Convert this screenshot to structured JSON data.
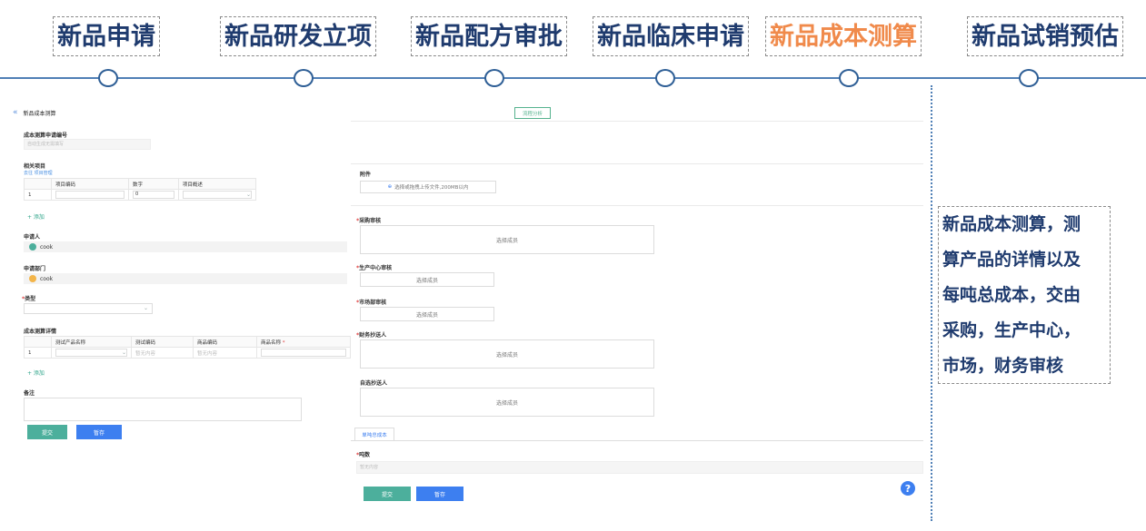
{
  "steps": [
    {
      "label": "新品申请",
      "active": false
    },
    {
      "label": "新品研发立项",
      "active": false
    },
    {
      "label": "新品配方审批",
      "active": false
    },
    {
      "label": "新品临床申请",
      "active": false
    },
    {
      "label": "新品成本测算",
      "active": true
    },
    {
      "label": "新品试销预估",
      "active": false
    }
  ],
  "form": {
    "title": "新品成本测算",
    "flow_button": "流程分析",
    "apply_no_label": "成本测算申请编号",
    "apply_no_placeholder": "自动生成无需填写",
    "related_label": "相关项目",
    "related_links": "去往 项目管理",
    "related_table": {
      "headers": [
        "项目编码",
        "数字",
        "项目概述"
      ],
      "rows": [
        {
          "idx": "1",
          "code": "",
          "num": "0",
          "desc": ""
        }
      ]
    },
    "add_label": "+ 添加",
    "applicant_label": "申请人",
    "applicant_value": "cook",
    "dept_label": "申请部门",
    "dept_value": "cook",
    "type_label": "类型",
    "detail_label": "成本测算详情",
    "detail_table": {
      "headers": [
        "测试产品名称",
        "测试编码",
        "商品编码",
        "商品名称"
      ],
      "rows": [
        {
          "idx": "1",
          "name": "",
          "test_code": "暂无内容",
          "goods_code": "暂无内容",
          "goods_name": ""
        }
      ]
    },
    "remark_label": "备注",
    "submit": "提交",
    "save": "暂存"
  },
  "right": {
    "attach_label": "附件",
    "upload_text": "选择或拖拽上传文件,200MB以内",
    "purchase_label": "采购审核",
    "production_label": "生产中心审核",
    "market_label": "市场部审核",
    "finance_label": "财务抄送人",
    "optional_label": "自选抄送人",
    "select_member": "选择成员",
    "tab_label": "单吨总成本",
    "tonnage_label": "吨数",
    "tonnage_placeholder": "暂无内容",
    "submit": "提交",
    "save": "暂存",
    "help": "?"
  },
  "note": {
    "lines": [
      "新品成本测算，测",
      "算产品的详情以及",
      "每吨总成本，交由",
      "采购，生产中心，",
      "市场，财务审核"
    ]
  },
  "colors": {
    "title_text": "#1f3b6e",
    "active_step": "#f08a4b",
    "timeline": "#4f7fb5",
    "primary_blue": "#3d7ff0",
    "primary_green": "#4caf9c"
  }
}
